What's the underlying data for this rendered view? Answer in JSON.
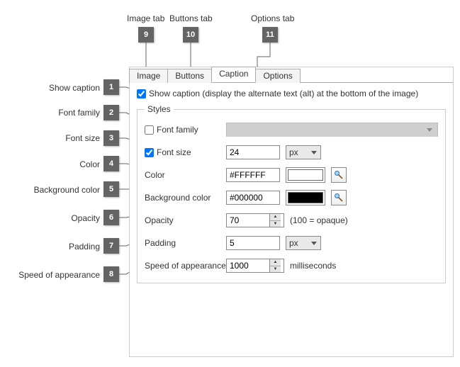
{
  "externalLabels": {
    "l1": "Show caption",
    "l2": "Font family",
    "l3": "Font size",
    "l4": "Color",
    "l5": "Background color",
    "l6": "Opacity",
    "l7": "Padding",
    "l8": "Speed of appearance",
    "l9": "Image tab",
    "l10": "Buttons tab",
    "l11": "Options tab"
  },
  "callouts": {
    "c1": "1",
    "c2": "2",
    "c3": "3",
    "c4": "4",
    "c5": "5",
    "c6": "6",
    "c7": "7",
    "c8": "8",
    "c9": "9",
    "c10": "10",
    "c11": "11"
  },
  "tabs": {
    "image": "Image",
    "buttons": "Buttons",
    "caption": "Caption",
    "options": "Options"
  },
  "showCaption": {
    "label": "Show caption (display the alternate text (alt) at the bottom of the image)"
  },
  "stylesLegend": "Styles",
  "rows": {
    "fontFamily": {
      "label": "Font family"
    },
    "fontSize": {
      "label": "Font size",
      "value": "24",
      "unit": "px"
    },
    "color": {
      "label": "Color",
      "value": "#FFFFFF",
      "swatch": "#FFFFFF"
    },
    "bgcolor": {
      "label": "Background color",
      "value": "#000000",
      "swatch": "#000000"
    },
    "opacity": {
      "label": "Opacity",
      "value": "70",
      "hint": "(100 = opaque)"
    },
    "padding": {
      "label": "Padding",
      "value": "5",
      "unit": "px"
    },
    "speed": {
      "label": "Speed of appearance",
      "value": "1000",
      "hint": "milliseconds"
    }
  }
}
